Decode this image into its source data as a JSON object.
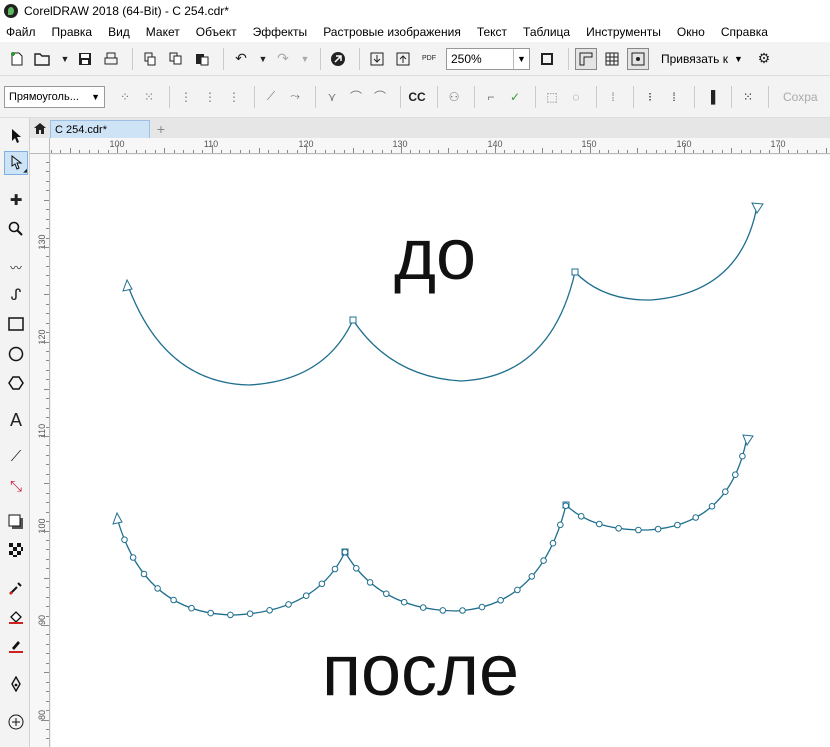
{
  "window": {
    "title": "CorelDRAW 2018 (64-Bit) - C 254.cdr*"
  },
  "menu": [
    "Файл",
    "Правка",
    "Вид",
    "Макет",
    "Объект",
    "Эффекты",
    "Растровые изображения",
    "Текст",
    "Таблица",
    "Инструменты",
    "Окно",
    "Справка"
  ],
  "toolbar": {
    "zoom": "250%",
    "snap_label": "Привязать к",
    "pdf_label": "PDF"
  },
  "property_bar": {
    "shape_select": "Прямоуголь...",
    "save_label": "Сохра"
  },
  "tabs": [
    {
      "label": "С 254.cdr*"
    }
  ],
  "rulers": {
    "top": [
      "100",
      "110",
      "120",
      "130",
      "140",
      "150",
      "160",
      "170"
    ],
    "left": [
      "130",
      "120",
      "110",
      "100",
      "90",
      "80"
    ]
  },
  "canvas": {
    "before_label": "до",
    "after_label": "после",
    "curve_color": "#1f6f8f"
  },
  "colors": {
    "tab_active": "#cfe3f7",
    "tool_active": "#cde3f6"
  }
}
